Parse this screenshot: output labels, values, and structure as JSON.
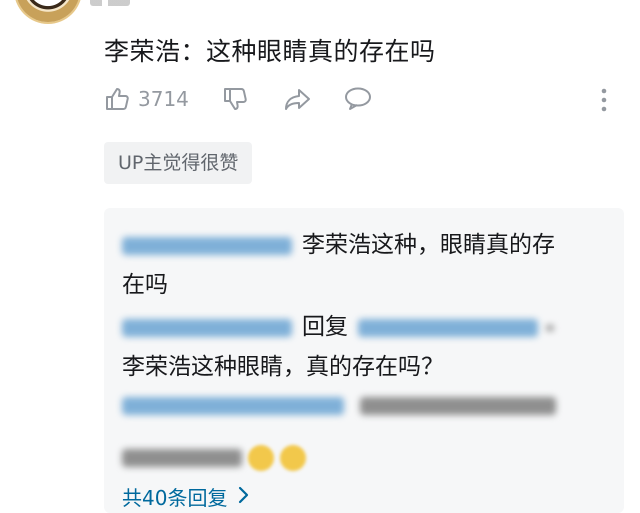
{
  "comment": {
    "text": "李荣浩：这种眼睛真的存在吗",
    "like_count": "3714"
  },
  "icons": {
    "like": "thumbs-up-icon",
    "dislike": "thumbs-down-icon",
    "share": "share-icon",
    "reply": "comment-bubble-icon",
    "more": "more-vertical-icon",
    "view_more": "chevron-right-icon"
  },
  "up_badge": "UP主觉得很赞",
  "replies": {
    "reply1_line1_text": "李荣浩这种，眼睛真的存",
    "reply1_line2_text": "在吗",
    "reply2_mid_label": "回复",
    "reply2_text": "李荣浩这种眼睛，真的存在吗？",
    "view_more_label": "共40条回复"
  },
  "colors": {
    "link": "#00699d",
    "secondary_text": "#9499a0",
    "reply_bg": "#f6f7f8"
  }
}
